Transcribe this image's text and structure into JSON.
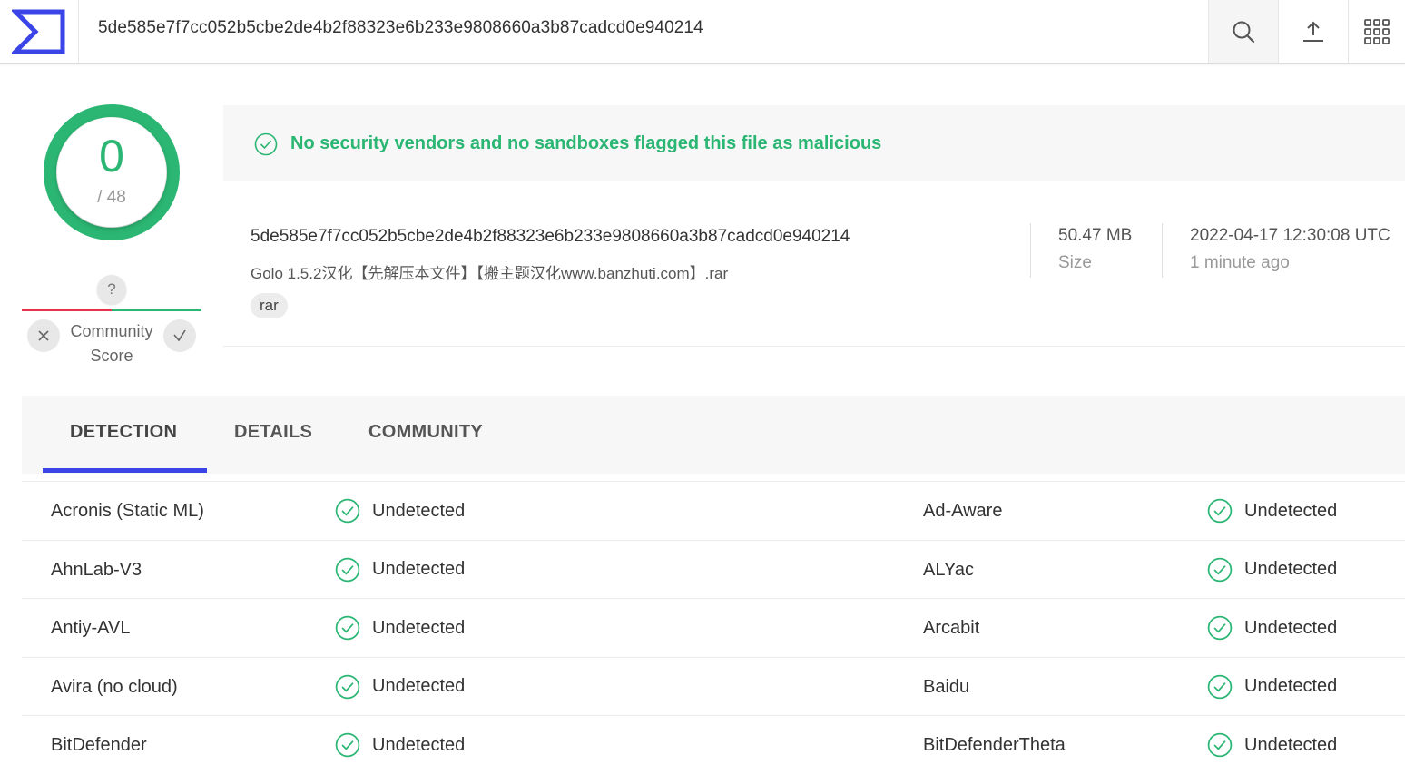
{
  "colors": {
    "accent": "#3b44e6",
    "clean": "#2bb673",
    "malicious": "#e8334f"
  },
  "header": {
    "search_value": "5de585e7f7cc052b5cbe2de4b2f88323e6b233e9808660a3b87cadcd0e940214",
    "icons": [
      "logo-icon",
      "search-icon",
      "upload-icon",
      "apps-grid-icon"
    ]
  },
  "score": {
    "detections": "0",
    "total": "/ 48",
    "detection_fraction": 0
  },
  "community": {
    "question": "?",
    "label": "Community\nScore"
  },
  "banner": {
    "message": "No security vendors and no sandboxes flagged this file as malicious"
  },
  "file": {
    "hash": "5de585e7f7cc052b5cbe2de4b2f88323e6b233e9808660a3b87cadcd0e940214",
    "name": "Golo 1.5.2汉化【先解压本文件】【搬主题汉化www.banzhuti.com】.rar",
    "tag": "rar",
    "size_value": "50.47 MB",
    "size_label": "Size",
    "date_value": "2022-04-17 12:30:08 UTC",
    "date_label": "1 minute ago"
  },
  "tabs": [
    {
      "label": "DETECTION",
      "active": true
    },
    {
      "label": "DETAILS",
      "active": false
    },
    {
      "label": "COMMUNITY",
      "active": false
    }
  ],
  "detections": [
    {
      "left": {
        "vendor": "Acronis (Static ML)",
        "status": "Undetected"
      },
      "right": {
        "vendor": "Ad-Aware",
        "status": "Undetected"
      }
    },
    {
      "left": {
        "vendor": "AhnLab-V3",
        "status": "Undetected"
      },
      "right": {
        "vendor": "ALYac",
        "status": "Undetected"
      }
    },
    {
      "left": {
        "vendor": "Antiy-AVL",
        "status": "Undetected"
      },
      "right": {
        "vendor": "Arcabit",
        "status": "Undetected"
      }
    },
    {
      "left": {
        "vendor": "Avira (no cloud)",
        "status": "Undetected"
      },
      "right": {
        "vendor": "Baidu",
        "status": "Undetected"
      }
    },
    {
      "left": {
        "vendor": "BitDefender",
        "status": "Undetected"
      },
      "right": {
        "vendor": "BitDefenderTheta",
        "status": "Undetected"
      }
    }
  ]
}
